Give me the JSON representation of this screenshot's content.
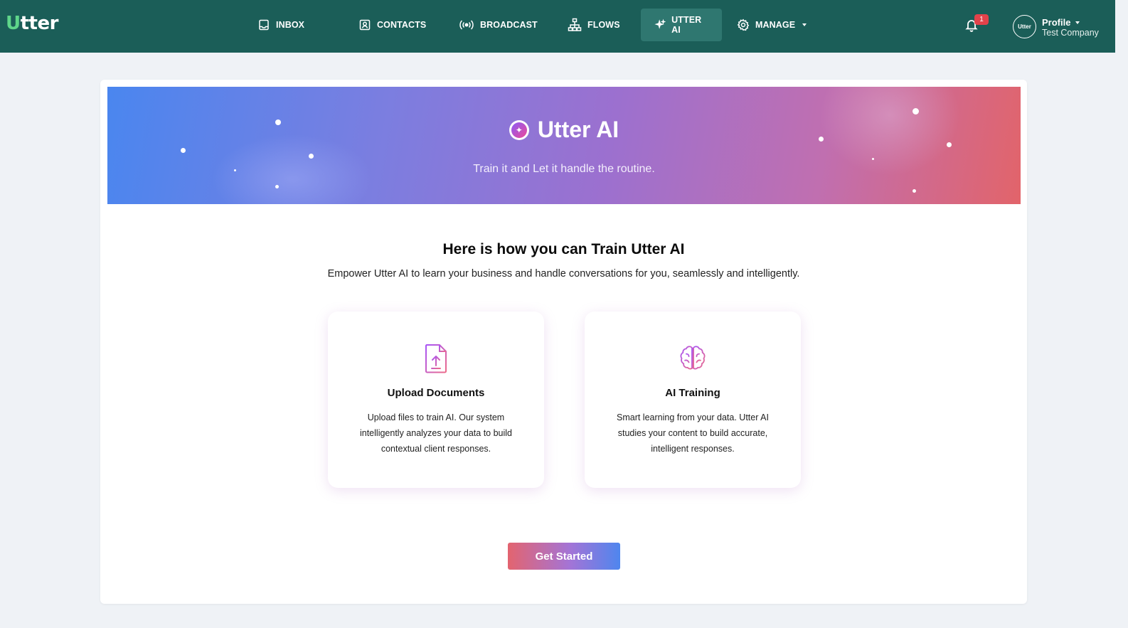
{
  "brand": {
    "logo_first": "U",
    "logo_rest": "tter"
  },
  "nav": {
    "inbox": "INBOX",
    "contacts": "CONTACTS",
    "broadcast": "BROADCAST",
    "flows": "FLOWS",
    "utter_ai": "UTTER AI",
    "manage": "MANAGE"
  },
  "notifications": {
    "count": "1"
  },
  "profile": {
    "avatar_text": "Utter",
    "name": "Profile",
    "company": "Test Company"
  },
  "hero": {
    "title": "Utter AI",
    "subtitle": "Train it and Let it handle the routine."
  },
  "section": {
    "title": "Here is how you can Train Utter AI",
    "subtitle": "Empower Utter AI to learn your business and handle conversations for you, seamlessly and intelligently."
  },
  "features": [
    {
      "title": "Upload Documents",
      "description": "Upload files to train AI. Our system intelligently analyzes your data to build contextual client responses.",
      "icon": "file-upload-icon"
    },
    {
      "title": "AI Training",
      "description": "Smart learning from your data. Utter AI studies your content to build accurate, intelligent responses.",
      "icon": "brain-icon"
    }
  ],
  "cta": {
    "label": "Get Started"
  },
  "colors": {
    "nav_bg": "#1b5e58",
    "accent_green": "#5fd68a",
    "badge": "#e2424a"
  }
}
